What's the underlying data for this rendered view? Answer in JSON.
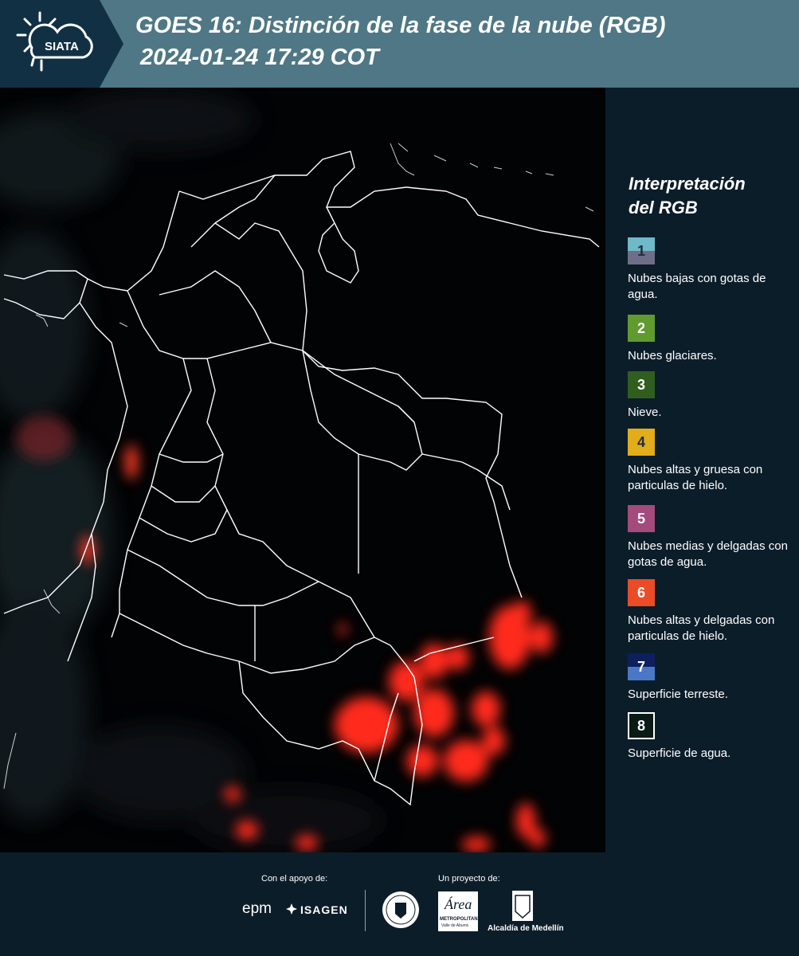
{
  "header": {
    "logo_text": "SIATA",
    "title_line1": "GOES 16: Distinción de la fase de la nube (RGB)",
    "title_line2": "2024-01-24 17:29 COT"
  },
  "legend": {
    "title_line1": "Interpretación",
    "title_line2": "del RGB",
    "items": [
      {
        "number": "1",
        "label": "Nubes bajas con gotas de agua.",
        "colors": [
          "#6fb9c9",
          "#6f6e88"
        ]
      },
      {
        "number": "2",
        "label": "Nubes glaciares.",
        "colors": [
          "#5f9b2f"
        ]
      },
      {
        "number": "3",
        "label": "Nieve.",
        "colors": [
          "#2f5e1f"
        ]
      },
      {
        "number": "4",
        "label": "Nubes altas y gruesa con particulas de hielo.",
        "colors": [
          "#e2ad1a"
        ]
      },
      {
        "number": "5",
        "label": "Nubes medias y delgadas con gotas de agua.",
        "colors": [
          "#a44a7c"
        ]
      },
      {
        "number": "6",
        "label": "Nubes altas y delgadas con particulas de hielo.",
        "colors": [
          "#ea4c27"
        ]
      },
      {
        "number": "7",
        "label": "Superficie terreste.",
        "colors": [
          "#0d1f5c",
          "#4a78c7"
        ]
      },
      {
        "number": "8",
        "label": "Superficie de agua.",
        "colors": [
          "#0a1a14"
        ]
      }
    ]
  },
  "footer": {
    "support_label": "Con el apoyo de:",
    "project_label": "Un proyecto de:",
    "sponsor_epm": "epm",
    "sponsor_isagen": "ISAGEN",
    "area_logo_text": "Área",
    "area_caption": "METROPOLITANA",
    "area_sub": "Valle de Aburrá",
    "alcaldia_text": "Alcaldía de Medellín"
  },
  "colors": {
    "header_bg": "#4f7785",
    "page_bg": "#0c1d2a",
    "map_bg": "#020304",
    "cloud_red": "#ff2a1e"
  }
}
